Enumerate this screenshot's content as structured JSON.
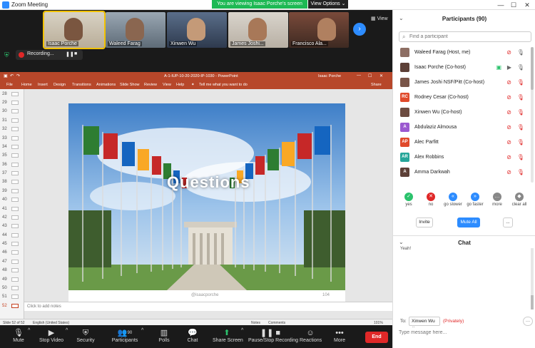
{
  "window": {
    "title": "Zoom Meeting",
    "minimize": "—",
    "maximize": "☐",
    "close": "✕"
  },
  "banner": {
    "text": "You are viewing Isaac Porche's screen",
    "view_options": "View Options ⌄"
  },
  "strip": {
    "tiles": [
      {
        "name": "Isaac Porche"
      },
      {
        "name": "Waleed Farag"
      },
      {
        "name": "Xinwen Wu"
      },
      {
        "name": "James Joshi..."
      },
      {
        "name": "Francisco Ala..."
      }
    ],
    "next": "›",
    "view_label": "View"
  },
  "recording": {
    "label": "Recording...",
    "pause": "❚❚",
    "stop": "■"
  },
  "ppt": {
    "filename": "A-1-IUP-10-20-2020-IP-1030  -  PowerPoint",
    "user": "Isaac Porche",
    "tabs": [
      "File",
      "Home",
      "Insert",
      "Design",
      "Transitions",
      "Animations",
      "Slide Show",
      "Review",
      "View",
      "Help",
      "Tell me what you want to do"
    ],
    "share": "Share",
    "thumbs": [
      "28",
      "29",
      "30",
      "31",
      "32",
      "33",
      "34",
      "35",
      "36",
      "37",
      "38",
      "39",
      "40",
      "41",
      "42",
      "43",
      "44",
      "45",
      "46",
      "47",
      "48",
      "49",
      "50",
      "51",
      "52"
    ],
    "slide": {
      "headline": "Questions",
      "credit": "@isaacporche",
      "page": "104"
    },
    "notes": "Click to add notes",
    "status": {
      "slide": "Slide 52 of 52",
      "lang": "English (United States)",
      "notes": "Notes",
      "comments": "Comments",
      "zoom": "101%"
    }
  },
  "toolbar": {
    "mute": "Mute",
    "video": "Stop Video",
    "security": "Security",
    "participants": "Participants",
    "participants_count": "90",
    "polls": "Polls",
    "chat": "Chat",
    "share": "Share Screen",
    "record": "Pause/Stop Recording",
    "reactions": "Reactions",
    "more": "More",
    "end": "End"
  },
  "panel": {
    "title": "Participants (90)",
    "search_placeholder": "Find a participant",
    "participants": [
      {
        "name": "Waleed Farag (Host, me)",
        "initials": "",
        "color": "#8d6e63"
      },
      {
        "name": "Isaac Porche (Co-host)",
        "initials": "",
        "color": "#5d4037"
      },
      {
        "name": "James Joshi NSF/Pitt (Co-host)",
        "initials": "",
        "color": "#795548"
      },
      {
        "name": "Rodney Cesar (Co-host)",
        "initials": "RC",
        "color": "#e04a2b"
      },
      {
        "name": "Xinwen Wu (Co-host)",
        "initials": "",
        "color": "#6d4c41"
      },
      {
        "name": "Abdulaziz Almousa",
        "initials": "A",
        "color": "#9b59d0"
      },
      {
        "name": "Alec Parfitt",
        "initials": "AP",
        "color": "#e04a2b"
      },
      {
        "name": "Alex Robbins",
        "initials": "AR",
        "color": "#26a69a"
      },
      {
        "name": "Amma Darkwah",
        "initials": "A",
        "color": "#5d4037"
      }
    ],
    "reactions": [
      {
        "label": "yes",
        "glyph": "✓",
        "color": "#2bc26c"
      },
      {
        "label": "no",
        "glyph": "✕",
        "color": "#e02828"
      },
      {
        "label": "go slower",
        "glyph": "«",
        "color": "#2d8cff"
      },
      {
        "label": "go faster",
        "glyph": "»",
        "color": "#2d8cff"
      },
      {
        "label": "more",
        "glyph": "…",
        "color": "#888888"
      },
      {
        "label": "clear all",
        "glyph": "◆",
        "color": "#888888"
      }
    ],
    "invite": "Invite",
    "mute_all": "Mute All",
    "more_btn": "...",
    "chat_title": "Chat",
    "chat_fragment": "Yeah!",
    "to_label": "To:",
    "to_value": "Xinwen Wu ⌄",
    "private": "(Privately)",
    "chat_placeholder": "Type message here..."
  }
}
